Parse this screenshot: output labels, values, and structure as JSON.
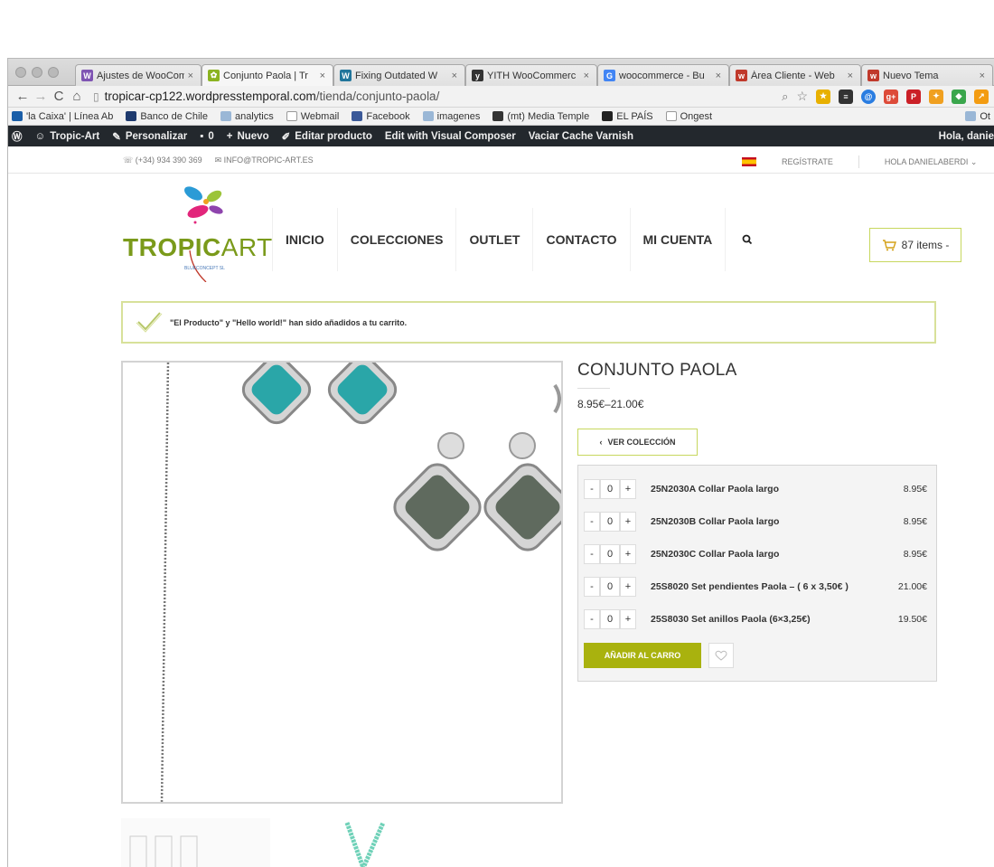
{
  "browser": {
    "tabs": [
      {
        "label": "Ajustes de WooCom",
        "icon": "woocommerce-favicon",
        "active": false
      },
      {
        "label": "Conjunto Paola | Tr",
        "icon": "tropicart-favicon",
        "active": true
      },
      {
        "label": "Fixing Outdated W",
        "icon": "wordpress-favicon",
        "active": false
      },
      {
        "label": "YITH WooCommerc",
        "icon": "yith-favicon",
        "active": false
      },
      {
        "label": "woocommerce - Bu",
        "icon": "google-favicon",
        "active": false
      },
      {
        "label": "Área Cliente - Web",
        "icon": "webempresa-favicon",
        "active": false
      },
      {
        "label": "Nuevo Tema",
        "icon": "webempresa-favicon",
        "active": false
      }
    ],
    "url_host": "tropicar-cp122.wordpresstemporal.com",
    "url_path": "/tienda/conjunto-paola/",
    "bookmarks": [
      "'la Caixa' | Línea Ab",
      "Banco de Chile",
      "analytics",
      "Webmail",
      "Facebook",
      "imagenes",
      "(mt) Media Temple",
      "EL PAÍS",
      "Ongest",
      "Ot"
    ]
  },
  "wp_admin_bar": {
    "site": "Tropic-Art",
    "customize": "Personalizar",
    "comments": "0",
    "new": "Nuevo",
    "edit": "Editar producto",
    "visual_composer": "Edit with Visual Composer",
    "cache": "Vaciar Cache Varnish",
    "greeting": "Hola, danie"
  },
  "site": {
    "phone": "(+34) 934 390 369",
    "email": "INFO@TROPIC-ART.ES",
    "register": "REGÍSTRATE",
    "account_greeting": "HOLA DANIELABERDI",
    "logo_tropic": "TROPIC",
    "logo_art": "ART",
    "logo_sub": "BLUECONCEPT SL",
    "menu": [
      "INICIO",
      "COLECCIONES",
      "OUTLET",
      "CONTACTO",
      "MI CUENTA"
    ],
    "cart_label": "87 items -",
    "notice": "\"El Producto\" y \"Hello world!\" han sido añadidos a tu carrito."
  },
  "product": {
    "title": "CONJUNTO PAOLA",
    "price_range": "8.95€–21.00€",
    "back_label": "VER COLECCIÓN",
    "items": [
      {
        "name": "25N2030A Collar Paola largo",
        "qty": "0",
        "price": "8.95€"
      },
      {
        "name": "25N2030B Collar Paola largo",
        "qty": "0",
        "price": "8.95€"
      },
      {
        "name": "25N2030C Collar Paola largo",
        "qty": "0",
        "price": "8.95€"
      },
      {
        "name": "25S8020 Set pendientes Paola – ( 6 x 3,50€ )",
        "qty": "0",
        "price": "21.00€"
      },
      {
        "name": "25S8030 Set anillos Paola (6×3,25€)",
        "qty": "0",
        "price": "19.50€"
      }
    ],
    "add_to_cart": "AÑADIR AL CARRO"
  },
  "colors": {
    "accent": "#a9b20e",
    "brand_green": "#7a9a1a",
    "turquoise": "#2aa6a8",
    "gray_stone": "#5f6a5e"
  }
}
